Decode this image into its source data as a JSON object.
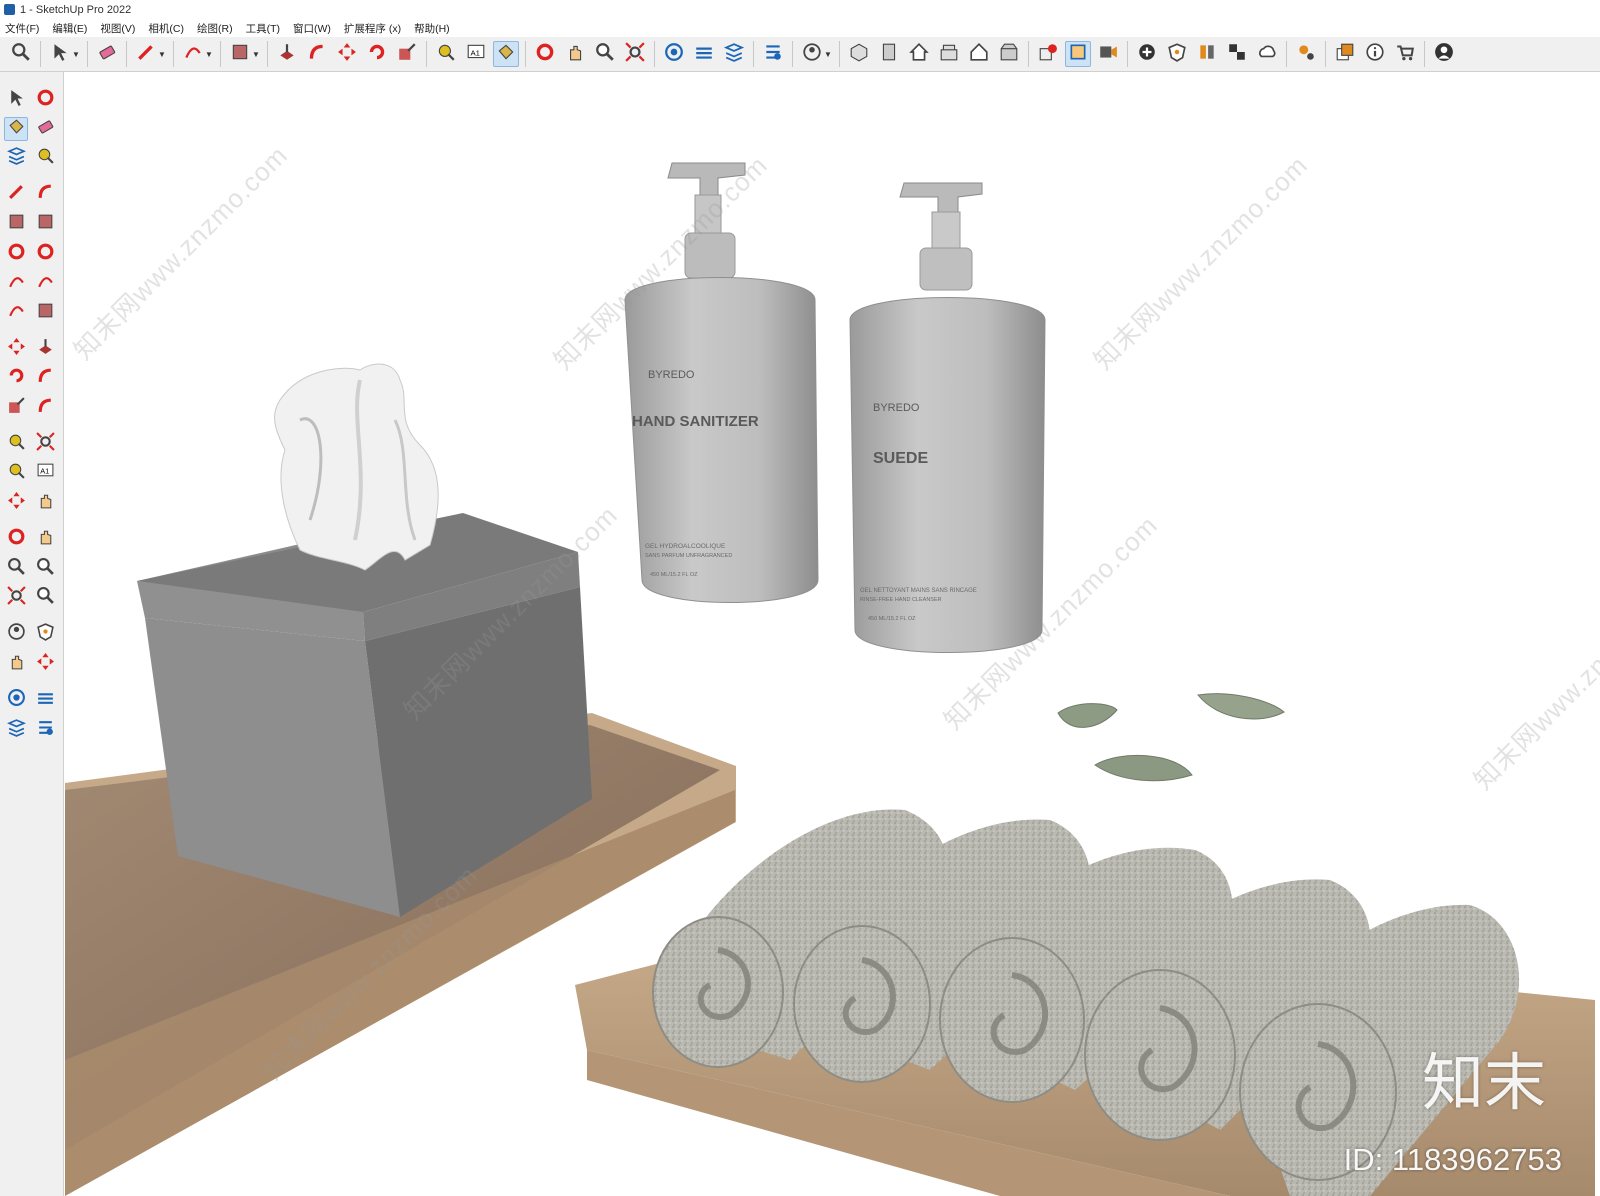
{
  "window": {
    "title": "1 - SketchUp Pro 2022"
  },
  "menu": [
    "文件(F)",
    "编辑(E)",
    "视图(V)",
    "相机(C)",
    "绘图(R)",
    "工具(T)",
    "窗口(W)",
    "扩展程序 (x)",
    "帮助(H)"
  ],
  "products": {
    "bottle1": {
      "brand": "BYREDO",
      "name": "HAND SANITIZER",
      "fine1": "GEL HYDROALCOOLIQUE",
      "fine2": "SANS PARFUM UNFRAGRANCED",
      "volume": "450 ML/15.2 FL OZ"
    },
    "bottle2": {
      "brand": "BYREDO",
      "name": "SUEDE",
      "fine1": "GEL NETTOYANT MAINS SANS RINCAGE",
      "fine2": "RINSE-FREE HAND CLEANSER",
      "volume": "450 ML/15.2 FL OZ"
    }
  },
  "watermark": "知末网www.znzmo.com",
  "logo": "知末",
  "asset_id": "ID: 1183962753",
  "colors": {
    "toolbar_bg": "#f0f0f0",
    "active_tool": "#cde3f5",
    "tray_wood": "#8d7663",
    "box_gray": "#8a8a8a",
    "towel": "#bcbcb4",
    "leaf": "#8f9c86"
  },
  "toolbar_icons": [
    "zoom-icon",
    "select-icon",
    "eraser-icon",
    "pencil-icon",
    "arc-icon",
    "rectangle-icon",
    "push-pull-icon",
    "follow-me-icon",
    "move-icon",
    "rotate-icon",
    "scale-icon",
    "tape-measure-icon",
    "text-icon",
    "paint-bucket-icon",
    "orbit-icon",
    "pan-icon",
    "zoom-window-icon",
    "zoom-extents-icon",
    "warehouse-icon",
    "share-model-icon",
    "components-icon",
    "extensions-icon",
    "user-icon",
    "iso-view-icon",
    "front-view-icon",
    "home-view-icon",
    "top-view-icon",
    "right-view-icon",
    "back-view-icon",
    "solid-tools-icon",
    "section-plane-icon",
    "scenes-icon",
    "add-location-icon",
    "shield-icon",
    "styles-icon",
    "checker-icon",
    "cloud-icon",
    "settings-icon",
    "layers-icon",
    "info-icon",
    "cart-icon",
    "account-icon"
  ]
}
